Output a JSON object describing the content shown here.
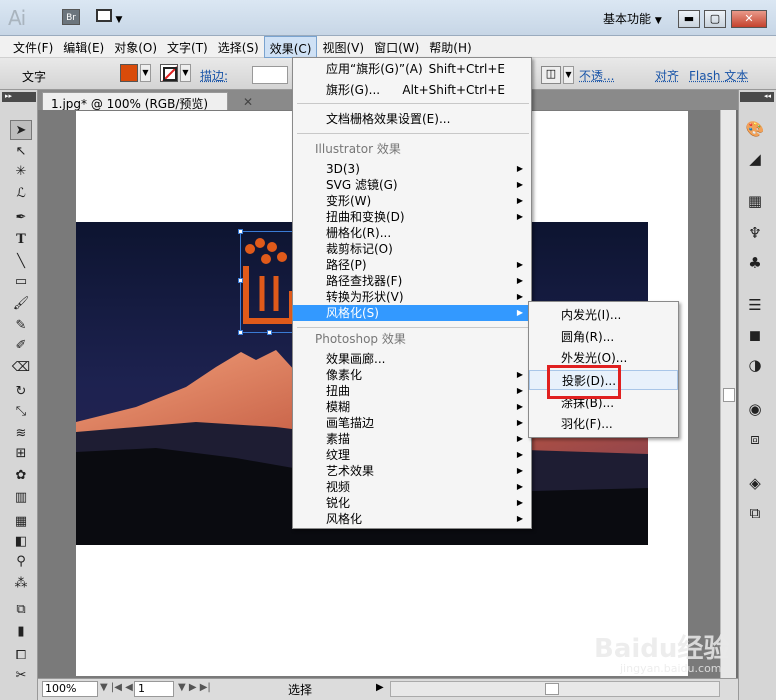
{
  "app": {
    "logo": "Ai",
    "bridge": "Br",
    "workspace": "基本功能"
  },
  "menubar": [
    "文件(F)",
    "编辑(E)",
    "对象(O)",
    "文字(T)",
    "选择(S)",
    "效果(C)",
    "视图(V)",
    "窗口(W)",
    "帮助(H)"
  ],
  "control": {
    "label": "文字",
    "stroke_label": "描边:",
    "opacity": "不透...",
    "align": "对齐",
    "flash": "Flash 文本",
    "fill_color": "#d94b0a"
  },
  "document": {
    "tab": "1.jpg* @ 100% (RGB/预览)",
    "zoom": "100%",
    "page": "1",
    "status": "选择"
  },
  "effect_menu": {
    "apply": {
      "label": "应用“旗形(G)”(A)",
      "shortcut": "Shift+Ctrl+E"
    },
    "flag": {
      "label": "旗形(G)...",
      "shortcut": "Alt+Shift+Ctrl+E"
    },
    "doc_raster": "文档栅格效果设置(E)...",
    "ai_heading": "Illustrator 效果",
    "ai_items": [
      "3D(3)",
      "SVG 滤镜(G)",
      "变形(W)",
      "扭曲和变换(D)",
      "栅格化(R)...",
      "裁剪标记(O)",
      "路径(P)",
      "路径查找器(F)",
      "转换为形状(V)",
      "风格化(S)"
    ],
    "ps_heading": "Photoshop 效果",
    "ps_items": [
      "效果画廊...",
      "像素化",
      "扭曲",
      "模糊",
      "画笔描边",
      "素描",
      "纹理",
      "艺术效果",
      "视频",
      "锐化",
      "风格化"
    ]
  },
  "stylize_submenu": [
    "内发光(I)...",
    "圆角(R)...",
    "外发光(O)...",
    "投影(D)...",
    "涂抹(B)...",
    "羽化(F)..."
  ],
  "watermark": {
    "main": "Baidu经验",
    "sub": "jingyan.baidu.com"
  }
}
